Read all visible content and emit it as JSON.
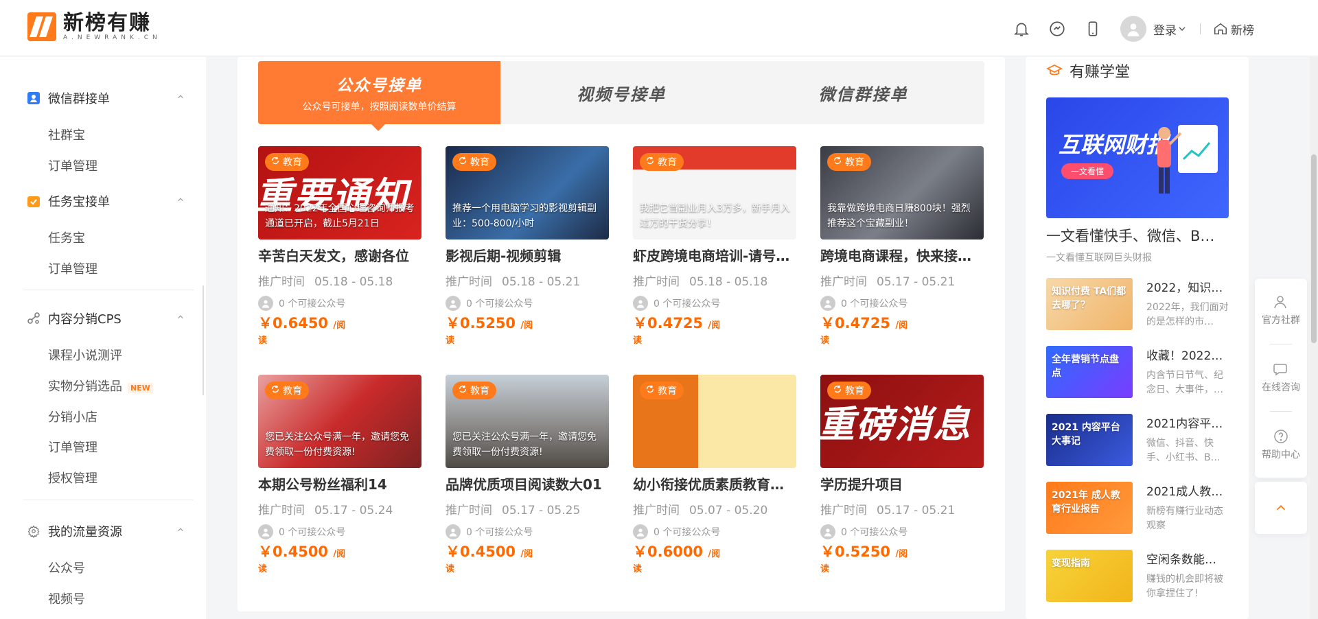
{
  "header": {
    "logo_title": "新榜有赚",
    "logo_sub": "A.NEWRANK.CN",
    "login_label": "登录",
    "home_label": "新榜",
    "icons": [
      "bell-icon",
      "chat-icon",
      "phone-icon",
      "avatar-icon",
      "home-icon"
    ]
  },
  "sidebar": {
    "sections": [
      {
        "label": "微信群接单",
        "icon": "wechat-group-icon",
        "items": [
          "社群宝",
          "订单管理"
        ]
      },
      {
        "label": "任务宝接单",
        "icon": "task-icon",
        "items": [
          "任务宝",
          "订单管理"
        ]
      },
      {
        "label": "内容分销CPS",
        "icon": "share-icon",
        "items": [
          "课程小说测评",
          "实物分销选品",
          "分销小店",
          "订单管理",
          "授权管理"
        ]
      },
      {
        "label": "我的流量资源",
        "icon": "gear-icon",
        "items": [
          "公众号",
          "视频号"
        ]
      }
    ],
    "new_badge": "NEW"
  },
  "tabs": [
    {
      "title": "公众号接单",
      "subtitle": "公众号可接单，按照阅读数单价结算",
      "active": true
    },
    {
      "title": "视频号接单",
      "active": false
    },
    {
      "title": "微信群接单",
      "active": false
    }
  ],
  "cards": [
    {
      "tag": "教育",
      "caption": "通知：2022年全国心理咨询师报考通道已开启，截止5月21日",
      "big": "重要通知",
      "title": "辛苦白天发文，感谢各位",
      "time_label": "推广时间",
      "time": "05.18 - 05.18",
      "accounts": "0 个可接公众号",
      "price": "￥0.6450",
      "unit": "/阅",
      "unit2": "读",
      "bg": "linear-gradient(135deg,#b31212,#d9231f)"
    },
    {
      "tag": "教育",
      "caption": "推荐一个用电脑学习的影视剪辑副业：500-800/小时",
      "big": "",
      "title": "影视后期-视频剪辑",
      "time_label": "推广时间",
      "time": "05.18 - 05.21",
      "accounts": "0 个可接公众号",
      "price": "￥0.5250",
      "unit": "/阅",
      "unit2": "读",
      "bg": "linear-gradient(135deg,#1b2a4a,#3a6ea8 60%,#1d2b45)"
    },
    {
      "tag": "教育",
      "caption": "我把它当副业月入3万多，新手月入过万的干货分享！",
      "big": "",
      "title": "虾皮跨境电商培训-请号…",
      "time_label": "推广时间",
      "time": "05.18 - 05.18",
      "accounts": "0 个可接公众号",
      "price": "￥0.4725",
      "unit": "/阅",
      "unit2": "读",
      "bg": "linear-gradient(180deg,#e23b2b 0 25%,#f5f5f5 25% 100%)"
    },
    {
      "tag": "教育",
      "caption": "我靠做跨境电商日赚800块！强烈推荐这个宝藏副业！",
      "big": "",
      "title": "跨境电商课程，快来接…",
      "time_label": "推广时间",
      "time": "05.17 - 05.21",
      "accounts": "0 个可接公众号",
      "price": "￥0.4725",
      "unit": "/阅",
      "unit2": "读",
      "bg": "linear-gradient(135deg,#3a3c44,#7b7f88 55%,#2b2d33)"
    },
    {
      "tag": "教育",
      "caption": "您已关注公众号满一年，邀请您免费领取一份付费资源!",
      "big": "",
      "title": "本期公号粉丝福利14",
      "time_label": "推广时间",
      "time": "05.17 - 05.24",
      "accounts": "0 个可接公众号",
      "price": "￥0.4500",
      "unit": "/阅",
      "unit2": "读",
      "bg": "linear-gradient(135deg,#e9a0a0,#c92a2a 50%,#7d2222)"
    },
    {
      "tag": "教育",
      "caption": "您已关注公众号满一年，邀请您免费领取一份付费资源!",
      "big": "",
      "title": "品牌优质项目阅读数大01",
      "time_label": "推广时间",
      "time": "05.17 - 05.25",
      "accounts": "0 个可接公众号",
      "price": "￥0.4500",
      "unit": "/阅",
      "unit2": "读",
      "bg": "linear-gradient(180deg,#c6cfd8,#8c8a88 55%,#4f4a45)"
    },
    {
      "tag": "教育",
      "caption": "",
      "big": "",
      "title": "幼小衔接优质素质教育…",
      "time_label": "推广时间",
      "time": "05.07 - 05.20",
      "accounts": "0 个可接公众号",
      "price": "￥0.6000",
      "unit": "/阅",
      "unit2": "读",
      "bg": "linear-gradient(90deg,#e8751a 0 40%,#fbe7a6 40% 100%)"
    },
    {
      "tag": "教育",
      "caption": "",
      "big": "重磅消息",
      "title": "学历提升项目",
      "time_label": "推广时间",
      "time": "05.17 - 05.21",
      "accounts": "0 个可接公众号",
      "price": "￥0.5250",
      "unit": "/阅",
      "unit2": "读",
      "bg": "linear-gradient(135deg,#8d1010,#b51b1b)"
    }
  ],
  "right": {
    "title": "有赚学堂",
    "banner_title": "互联网财报",
    "banner_btn": "一文看懂",
    "featured_title": "一文看懂快手、微信、B站…",
    "featured_sub": "一文看懂互联网巨头财报",
    "list": [
      {
        "title": "2022，知识…",
        "desc": "2022年，我们面对的是怎样的市…",
        "thumb_text": "知识付费 TA们都去哪了？",
        "bg": "linear-gradient(135deg,#f7d8a8,#f0b46a)"
      },
      {
        "title": "收藏！2022…",
        "desc": "内含节日节气、纪念日、大事件，…",
        "thumb_text": "全年营销节点盘点",
        "bg": "linear-gradient(135deg,#2f6bff,#7a3cff)"
      },
      {
        "title": "2021内容平…",
        "desc": "微信、抖音、快手、小红书、B…",
        "thumb_text": "2021 内容平台 大事记",
        "bg": "linear-gradient(135deg,#1a2d8a,#3b5be0)"
      },
      {
        "title": "2021成人教…",
        "desc": "新榜有赚行业动态观察",
        "thumb_text": "2021年 成人教育行业报告",
        "bg": "linear-gradient(135deg,#ff7a1a,#ff9a3c)"
      },
      {
        "title": "空闲条数能…",
        "desc": "赚钱的机会即将被你拿捏住了!",
        "thumb_text": "变现指南",
        "bg": "linear-gradient(135deg,#f6d33a,#f2b51a)"
      }
    ]
  },
  "float_tools": [
    {
      "label": "官方社群",
      "icon": "user-group-icon"
    },
    {
      "label": "在线咨询",
      "icon": "chat-bubble-icon"
    },
    {
      "label": "帮助中心",
      "icon": "help-icon"
    }
  ],
  "colors": {
    "accent": "#ff7a1a",
    "price": "#ff6a00",
    "tab_active": "#ff7a33"
  }
}
